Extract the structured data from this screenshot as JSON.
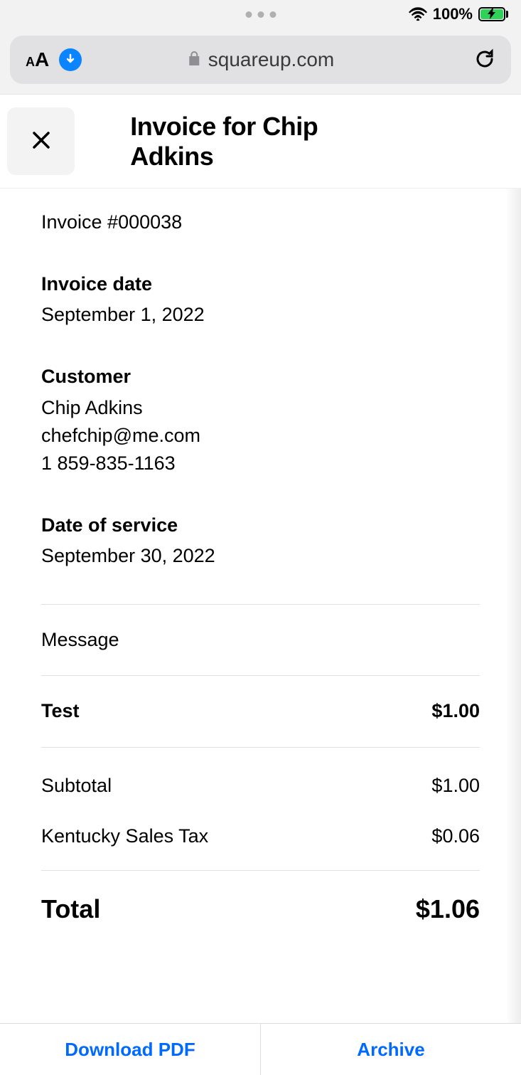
{
  "status": {
    "battery_pct": "100%"
  },
  "browser": {
    "url": "squareup.com"
  },
  "header": {
    "title": "Invoice for Chip Adkins"
  },
  "invoice": {
    "number": "Invoice #000038",
    "date_label": "Invoice date",
    "date_value": "September 1, 2022",
    "customer_label": "Customer",
    "customer_name": "Chip Adkins",
    "customer_email": "chefchip@me.com",
    "customer_phone": "1 859-835-1163",
    "service_date_label": "Date of service",
    "service_date_value": "September 30, 2022",
    "message_label": "Message",
    "item_name": "Test",
    "item_price": "$1.00",
    "subtotal_label": "Subtotal",
    "subtotal_value": "$1.00",
    "tax_label": "Kentucky Sales Tax",
    "tax_value": "$0.06",
    "total_label": "Total",
    "total_value": "$1.06"
  },
  "footer": {
    "download": "Download PDF",
    "archive": "Archive"
  }
}
